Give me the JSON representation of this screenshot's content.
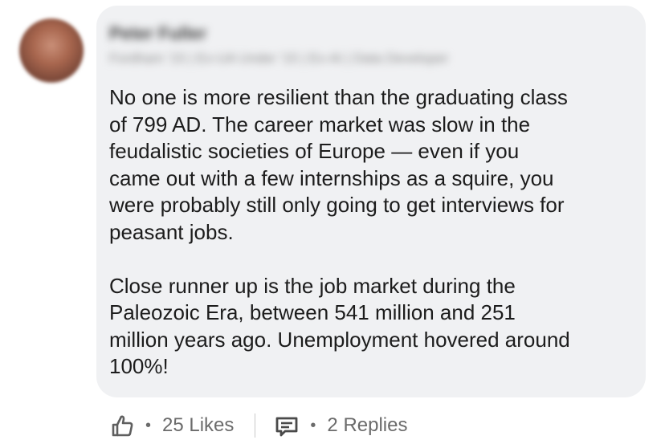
{
  "comment": {
    "author_name": "Peter Fuller",
    "author_subtitle": "Fordham '15 | Ex-UA Under '15 | Ex-AI | Data Developer",
    "body": "No one is more resilient than the graduating class\nof 799 AD. The career market was slow in the\nfeudalistic societies of Europe — even if you\ncame out with a few internships as a squire, you\nwere probably still only going to get interviews for\npeasant jobs.\n\nClose runner up is the job market during the\nPaleozoic Era, between 541 million and 251\nmillion years ago. Unemployment hovered around\n100%!"
  },
  "actions": {
    "like_icon": "thumbs-up-icon",
    "likes_label": "25 Likes",
    "separator": "•",
    "reply_icon": "comment-icon",
    "replies_label": "2 Replies"
  },
  "colors": {
    "bubble_background": "#f0f1f3",
    "text": "#1c1c1c",
    "muted": "#6b6b6b"
  }
}
